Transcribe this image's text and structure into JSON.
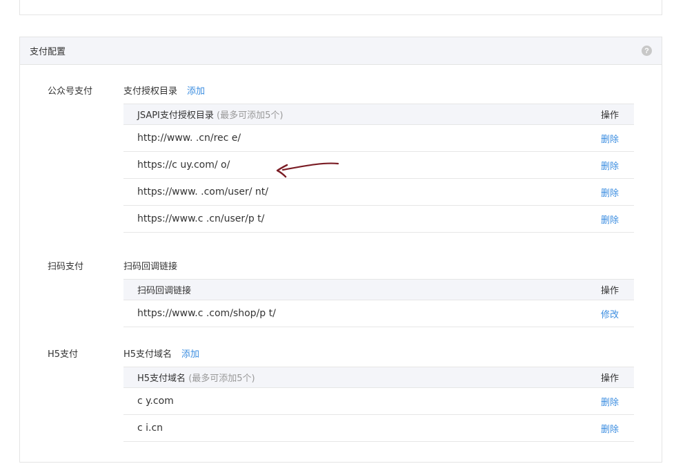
{
  "panel": {
    "title": "支付配置",
    "help_icon": "question-circle-icon"
  },
  "sections": {
    "jsapi": {
      "label": "公众号支付",
      "sub_label": "支付授权目录",
      "add_link": "添加",
      "table_header": "JSAPI支付授权目录",
      "table_hint": "(最多可添加5个)",
      "action_header": "操作",
      "rows": [
        {
          "url": "http://www.                .cn/rec        e/",
          "action": "删除"
        },
        {
          "url": "https://c           uy.com/      o/",
          "action": "删除"
        },
        {
          "url": "https://www.                  .com/user/                nt/",
          "action": "删除"
        },
        {
          "url": "https://www.c              .cn/user/p             t/",
          "action": "删除"
        }
      ]
    },
    "scan": {
      "label": "扫码支付",
      "sub_label": "扫码回调链接",
      "table_header": "扫码回调链接",
      "action_header": "操作",
      "rows": [
        {
          "url": "https://www.c              .com/shop/p            t/",
          "action": "修改"
        }
      ]
    },
    "h5": {
      "label": "H5支付",
      "sub_label": "H5支付域名",
      "add_link": "添加",
      "table_header": "H5支付域名",
      "table_hint": "(最多可添加5个)",
      "action_header": "操作",
      "rows": [
        {
          "url": "c           y.com",
          "action": "删除"
        },
        {
          "url": "c           i.cn",
          "action": "删除"
        }
      ]
    }
  },
  "colors": {
    "link": "#3b8de0",
    "header_bg": "#f4f5f9",
    "border": "#e4e4e4",
    "annotation": "#7a1c24"
  }
}
